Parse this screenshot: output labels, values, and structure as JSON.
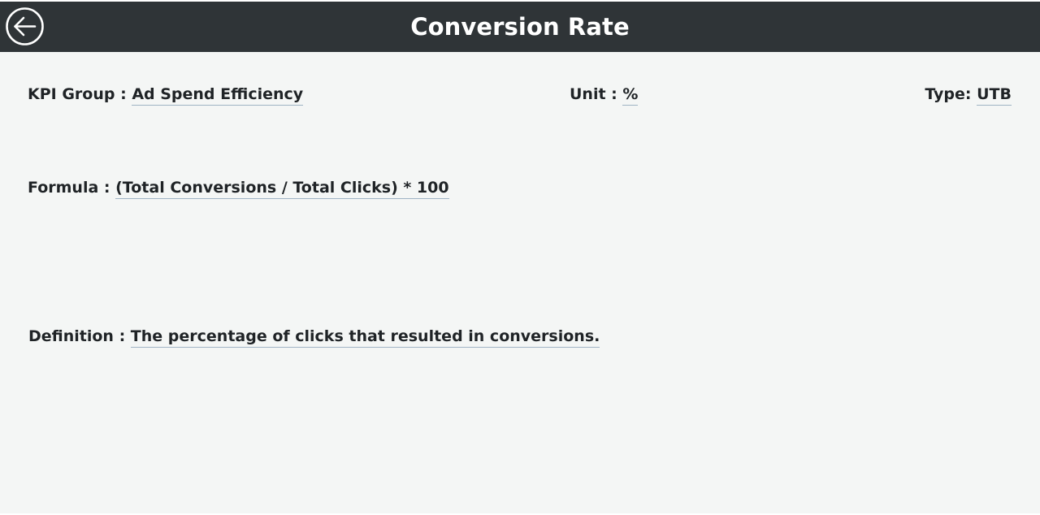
{
  "header": {
    "title": "Conversion Rate",
    "back_icon": "arrow-left-circle-icon",
    "background_color": "#2f3437"
  },
  "kpi_group": {
    "label": "KPI Group : ",
    "value": "Ad Spend Efficiency"
  },
  "unit": {
    "label": "Unit : ",
    "value": "%"
  },
  "type": {
    "label": "Type: ",
    "value": "UTB"
  },
  "formula": {
    "label": "Formula : ",
    "value": "(Total Conversions / Total Clicks) * 100"
  },
  "definition": {
    "label": "Definition : ",
    "value": "The percentage of clicks that resulted in conversions."
  }
}
